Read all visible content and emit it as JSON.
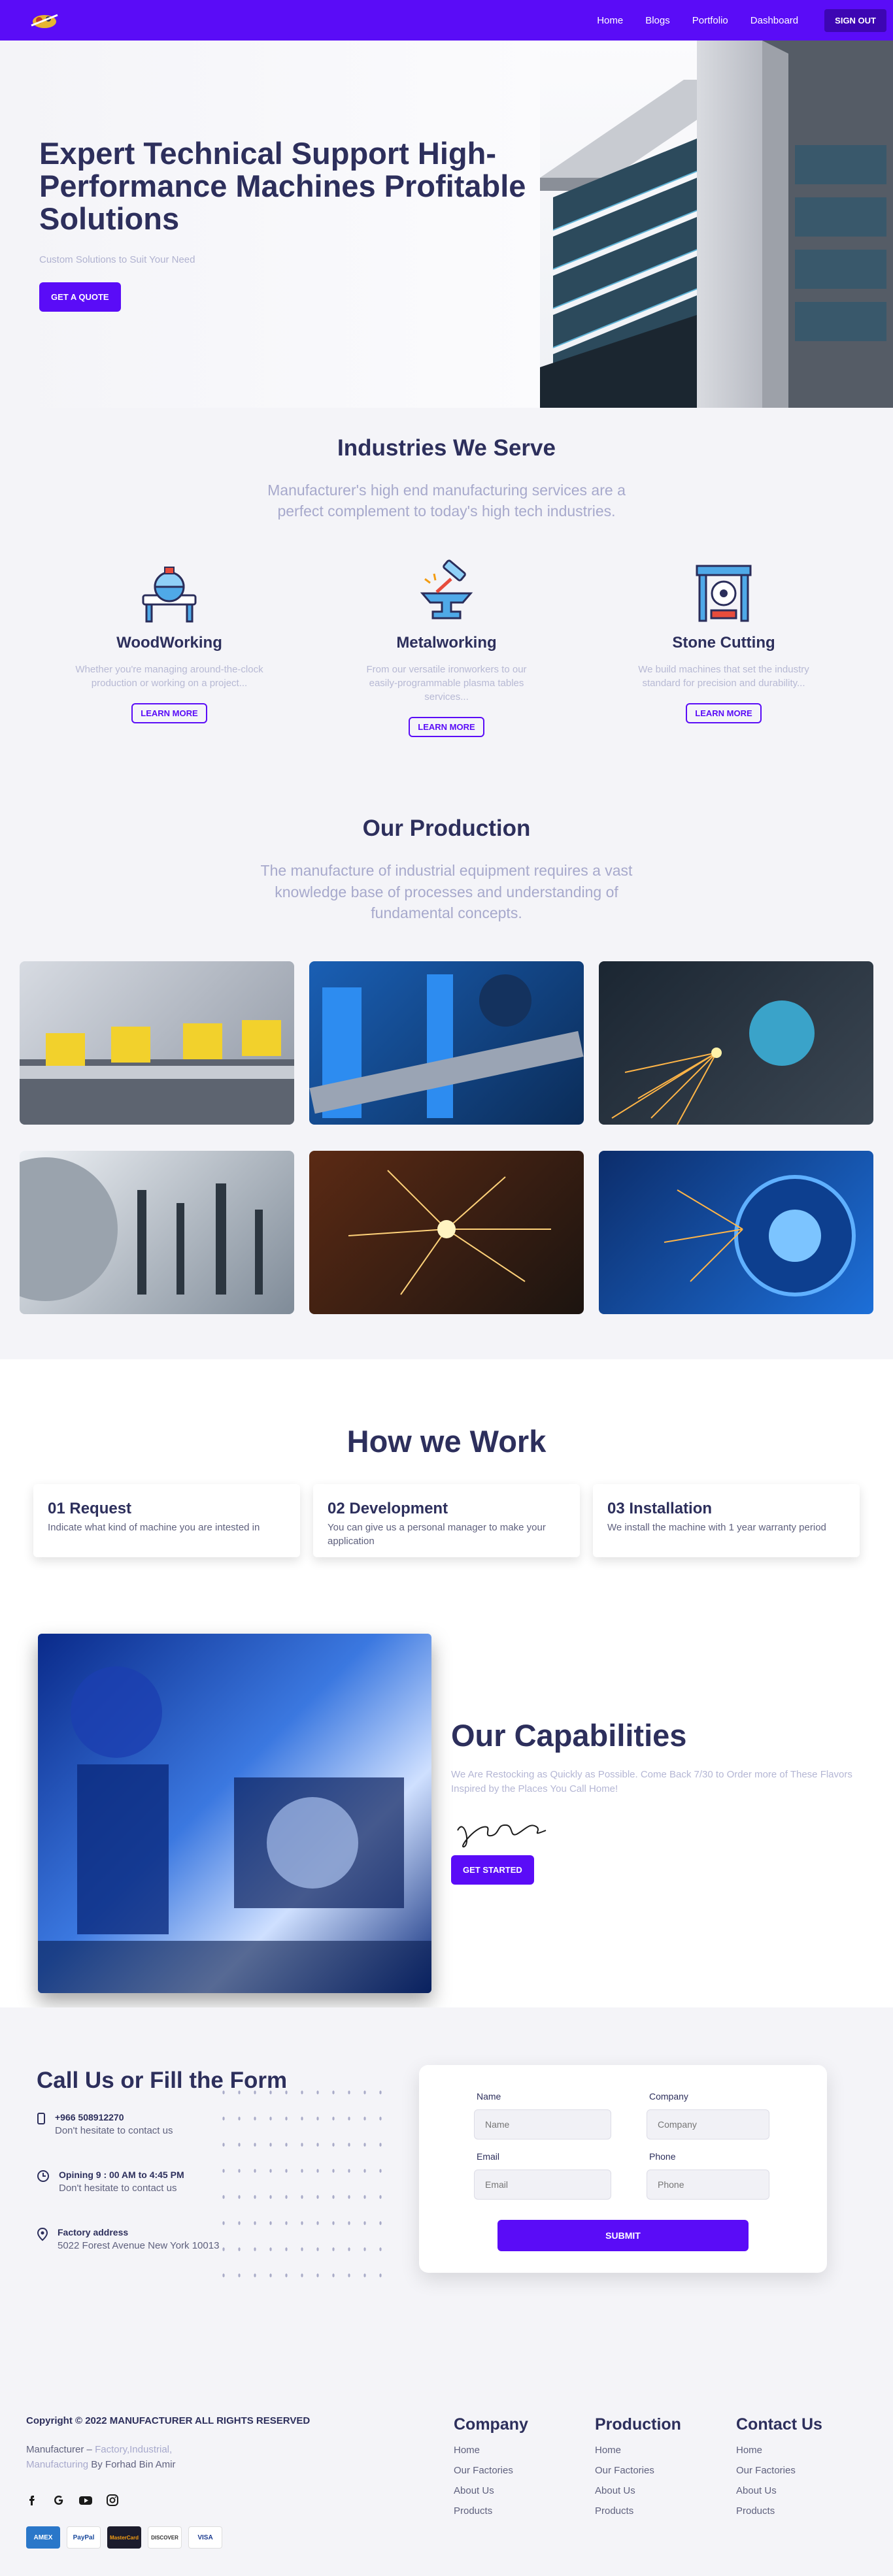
{
  "nav": {
    "links": [
      "Home",
      "Blogs",
      "Portfolio",
      "Dashboard"
    ],
    "signout": "SIGN OUT"
  },
  "hero": {
    "title": "Expert Technical Support High-Performance Machines Profitable Solutions",
    "subtitle": "Custom Solutions to Suit Your Need",
    "cta": "GET A QUOTE"
  },
  "industries": {
    "title": "Industries We Serve",
    "subtitle": "Manufacturer's high end manufacturing services are a perfect complement to today's high tech industries.",
    "items": [
      {
        "title": "WoodWorking",
        "text": "Whether you're managing around-the-clock production or working on a project...",
        "button": "LEARN MORE",
        "icon": "saw-icon"
      },
      {
        "title": "Metalworking",
        "text": "From our versatile ironworkers to our easily-programmable plasma tables services...",
        "button": "LEARN MORE",
        "icon": "anvil-hammer-icon"
      },
      {
        "title": "Stone Cutting",
        "text": "We build machines that set the industry standard for precision and durability...",
        "button": "LEARN MORE",
        "icon": "stone-cutter-icon"
      }
    ]
  },
  "production": {
    "title": "Our Production",
    "subtitle": "The manufacture of industrial equipment requires a vast knowledge base of processes and understanding of fundamental concepts."
  },
  "how": {
    "title": "How we Work",
    "cards": [
      {
        "title": "01 Request",
        "text": "Indicate what kind of machine you are intested in"
      },
      {
        "title": "02 Development",
        "text": "You can give us a personal manager to make your application"
      },
      {
        "title": "03 Installation",
        "text": "We install the machine with 1 year warranty period"
      }
    ]
  },
  "capabilities": {
    "title": "Our Capabilities",
    "text": "We Are Restocking as Quickly as Possible. Come Back 7/30 to Order more of These Flavors Inspired by the Places You Call Home!",
    "cta": "GET STARTED"
  },
  "contact": {
    "title": "Call Us or Fill the Form",
    "items": [
      {
        "title": "+966 508912270",
        "text": "Don't hesitate to contact us",
        "icon": "phone-icon"
      },
      {
        "title": "Opining 9 : 00 AM to 4:45 PM",
        "text": "Don't hesitate to contact us",
        "icon": "clock-icon"
      },
      {
        "title": "Factory address",
        "text": "5022 Forest Avenue New York 10013",
        "icon": "location-pin-icon"
      }
    ],
    "form": {
      "name_label": "Name",
      "name_placeholder": "Name",
      "company_label": "Company",
      "company_placeholder": "Company",
      "email_label": "Email",
      "email_placeholder": "Email",
      "phone_label": "Phone",
      "phone_placeholder": "Phone",
      "submit": "SUBMIT"
    }
  },
  "footer": {
    "copyright": "Copyright © 2022 MANUFACTURER ALL RIGHTS RESERVED",
    "credit_prefix": "Manufacturer",
    "credit_link": "Factory,Industrial, Manufacturing",
    "credit_suffix": "By Forhad Bin Amir",
    "columns": [
      {
        "title": "Company",
        "links": [
          "Home",
          "Our Factories",
          "About Us",
          "Products"
        ]
      },
      {
        "title": "Production",
        "links": [
          "Home",
          "Our Factories",
          "About Us",
          "Products"
        ]
      },
      {
        "title": "Contact Us",
        "links": [
          "Home",
          "Our Factories",
          "About Us",
          "Products"
        ]
      }
    ],
    "payments": [
      "AMEX",
      "PayPal",
      "MasterCard",
      "DISCOVER",
      "VISA"
    ]
  }
}
